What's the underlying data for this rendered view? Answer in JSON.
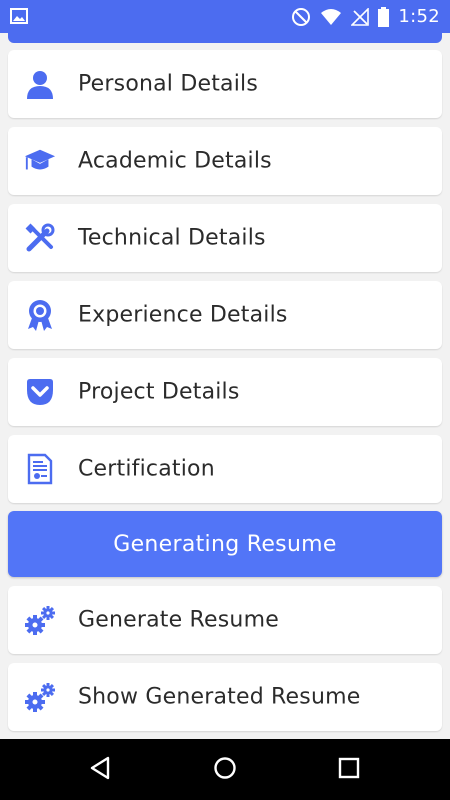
{
  "status_bar": {
    "time": "1:52",
    "icons": [
      "image-icon",
      "dnd-icon",
      "wifi-icon",
      "no-signal-icon",
      "battery-icon"
    ]
  },
  "menu": {
    "items": [
      {
        "label": "Personal Details",
        "icon": "person-icon"
      },
      {
        "label": "Academic Details",
        "icon": "graduation-cap-icon"
      },
      {
        "label": "Technical Details",
        "icon": "tools-icon"
      },
      {
        "label": "Experience Details",
        "icon": "award-icon"
      },
      {
        "label": "Project Details",
        "icon": "pocket-icon"
      },
      {
        "label": "Certification",
        "icon": "certificate-icon"
      }
    ],
    "generating_label": "Generating Resume",
    "actions": [
      {
        "label": "Generate Resume",
        "icon": "gears-icon"
      },
      {
        "label": "Show Generated Resume",
        "icon": "gears-icon"
      }
    ]
  },
  "colors": {
    "accent": "#4c6cf0",
    "button": "#5275f7",
    "background": "#f2f2f2"
  },
  "nav_bar": {
    "buttons": [
      "back-icon",
      "home-icon",
      "recents-icon"
    ]
  }
}
